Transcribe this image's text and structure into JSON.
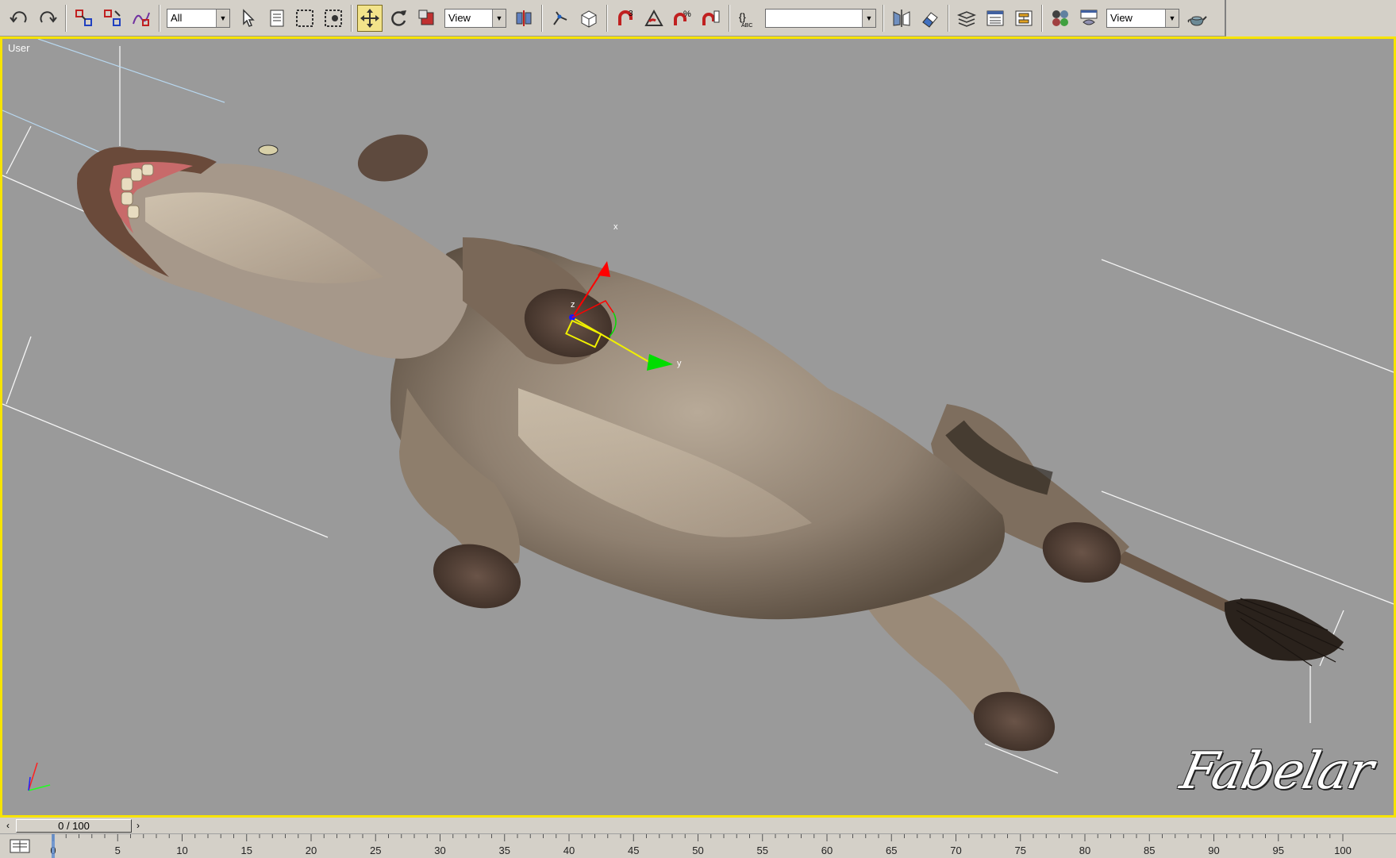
{
  "toolbar": {
    "selection_filter": "All",
    "ref_coord_1": "View",
    "named_selection": "",
    "ref_coord_2": "View",
    "items": [
      {
        "name": "undo-icon"
      },
      {
        "name": "redo-icon"
      },
      {
        "name": "select-and-link-icon"
      },
      {
        "name": "unlink-selection-icon"
      },
      {
        "name": "bind-to-space-warp-icon"
      },
      {
        "name": "select-object-icon"
      },
      {
        "name": "select-by-name-icon"
      },
      {
        "name": "rectangular-selection-icon"
      },
      {
        "name": "window-crossing-icon"
      },
      {
        "name": "select-and-move-icon",
        "active": true
      },
      {
        "name": "select-and-rotate-icon"
      },
      {
        "name": "select-and-scale-icon"
      },
      {
        "name": "use-pivot-center-icon"
      },
      {
        "name": "select-and-manipulate-icon"
      },
      {
        "name": "keyboard-shortcut-override-icon"
      },
      {
        "name": "snaps-toggle-icon"
      },
      {
        "name": "angle-snap-icon"
      },
      {
        "name": "percent-snap-icon"
      },
      {
        "name": "spinner-snap-icon"
      },
      {
        "name": "edit-named-selection-icon"
      },
      {
        "name": "mirror-icon"
      },
      {
        "name": "align-icon"
      },
      {
        "name": "layer-manager-icon"
      },
      {
        "name": "curve-editor-icon"
      },
      {
        "name": "schematic-view-icon"
      },
      {
        "name": "material-editor-icon"
      },
      {
        "name": "render-setup-icon"
      },
      {
        "name": "render-teapot-icon"
      }
    ]
  },
  "viewport": {
    "label": "User",
    "gizmo_labels": {
      "x": "x",
      "y": "y",
      "z": "z"
    },
    "watermark": "Fabelar"
  },
  "timeline": {
    "current": "0 / 100",
    "ticks": [
      "0",
      "5",
      "10",
      "15",
      "20",
      "25",
      "30",
      "35",
      "40",
      "45",
      "50",
      "55",
      "60",
      "65",
      "70",
      "75",
      "80",
      "85",
      "90",
      "95",
      "100"
    ]
  },
  "colors": {
    "viewport_border": "#f7e400",
    "viewport_bg": "#9a9a9a",
    "ui_bg": "#d4d0c8",
    "active_tool": "#f2e38a"
  }
}
